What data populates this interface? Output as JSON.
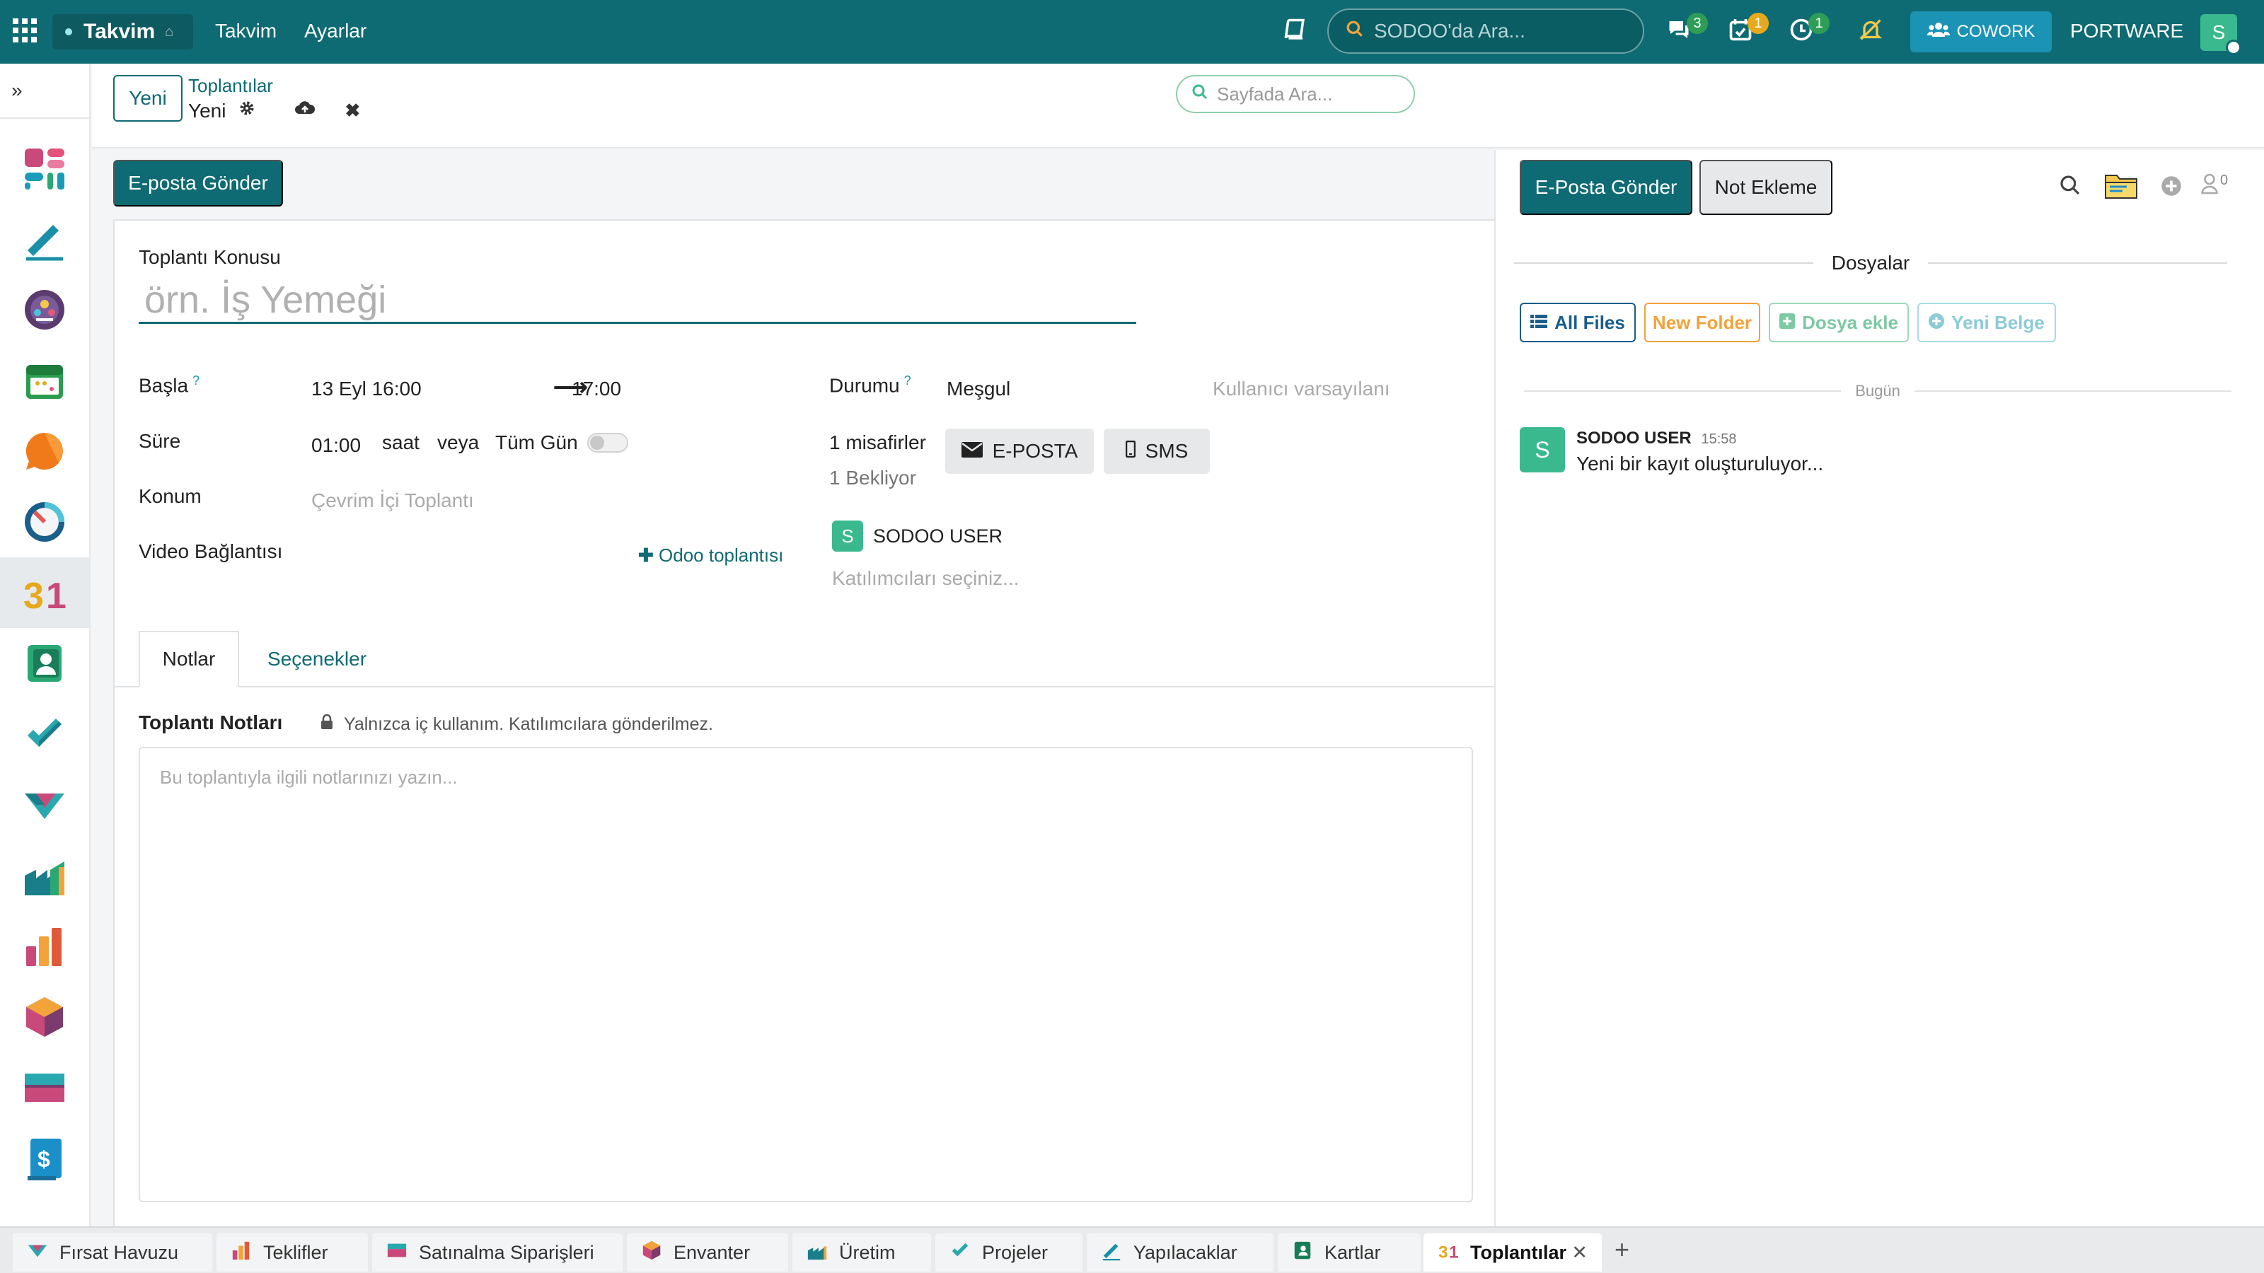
{
  "topbar": {
    "app_name": "Takvim",
    "nav": [
      "Takvim",
      "Ayarlar"
    ],
    "search_placeholder": "SODOO'da Ara...",
    "badges": {
      "messages": "3",
      "activities": "1",
      "timers": "1"
    },
    "cowork_label": "COWORK",
    "company": "PORTWARE",
    "user_initial": "S",
    "colors": {
      "bar": "#0f6b73",
      "cowork": "#1b93b5",
      "avatar": "#3bb98e"
    }
  },
  "control": {
    "new_button": "Yeni",
    "breadcrumb_parent": "Toplantılar",
    "breadcrumb_current": "Yeni",
    "search_placeholder": "Sayfada Ara..."
  },
  "form": {
    "send_email": "E-posta Gönder",
    "subject_label": "Toplantı Konusu",
    "subject_placeholder": "örn. İş Yemeği",
    "start_label": "Başla",
    "start_value": "13 Eyl 16:00",
    "end_value": "17:00",
    "status_label": "Durumu",
    "status_value": "Meşgul",
    "status_default": "Kullanıcı varsayılanı",
    "duration_label": "Süre",
    "duration_value": "01:00",
    "hours": "saat",
    "or": "veya",
    "all_day": "Tüm Gün",
    "guests": "1 misafirler",
    "waiting": "1 Bekliyor",
    "email_button": "E-POSTA",
    "sms_button": "SMS",
    "location_label": "Konum",
    "location_placeholder": "Çevrim İçi Toplantı",
    "video_label": "Video Bağlantısı",
    "odoo_meeting": "Odoo toplantısı",
    "attendee_initial": "S",
    "attendee_name": "SODOO USER",
    "attendees_placeholder": "Katılımcıları seçiniz...",
    "tabs": [
      "Notlar",
      "Seçenekler"
    ],
    "notes_title": "Toplantı Notları",
    "notes_hint": "Yalnızca iç kullanım. Katılımcılara gönderilmez.",
    "notes_placeholder": "Bu toplantıyla ilgili notlarınızı yazın..."
  },
  "chatter": {
    "send_email": "E-Posta Gönder",
    "add_note": "Not Ekleme",
    "followers_count": "0",
    "files_title": "Dosyalar",
    "buttons": [
      "All Files",
      "New Folder",
      "Dosya ekle",
      "Yeni Belge"
    ],
    "today": "Bugün",
    "message": {
      "author": "SODOO USER",
      "time": "15:58",
      "body": "Yeni bir kayıt oluşturuluyor...",
      "initial": "S"
    }
  },
  "bottom_tabs": [
    "Fırsat Havuzu",
    "Teklifler",
    "Satınalma Siparişleri",
    "Envanter",
    "Üretim",
    "Projeler",
    "Yapılacaklar",
    "Kartlar",
    "Toplantılar"
  ],
  "rail_apps": [
    "dashboard-icon",
    "pen-icon",
    "people-circle-icon",
    "calendar-app-icon",
    "chat-bubble-icon",
    "gauge-icon",
    "calendar-31-icon",
    "contacts-icon",
    "check-icon",
    "handshake-icon",
    "manufacturing-icon",
    "chart-bars-icon",
    "box-icon",
    "card-icon",
    "invoice-icon"
  ]
}
